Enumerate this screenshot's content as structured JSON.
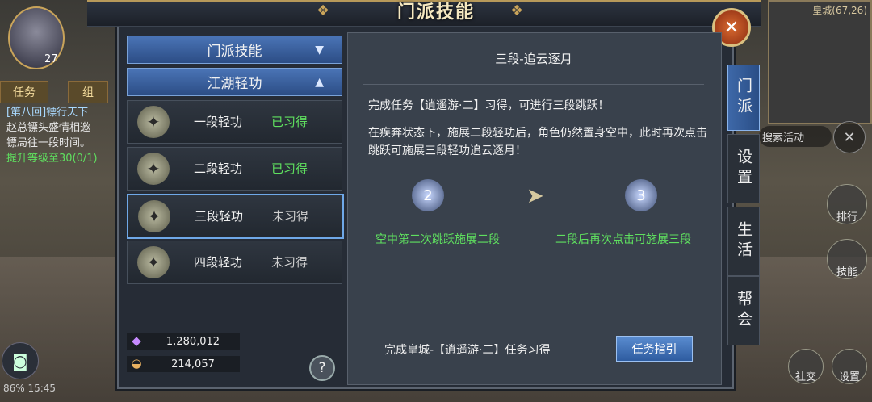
{
  "window": {
    "title": "门派技能"
  },
  "hud": {
    "level": "27",
    "tabs": [
      "任务",
      "组"
    ],
    "quest": {
      "line1": "[第八回]镖行天下",
      "line2": "赵总镖头盛情相邀",
      "line3": "镖局往一段时间。",
      "line4": "提升等级至30(0/1)"
    },
    "status": "86%  15:45",
    "map_coords": "皇城(67,26)",
    "search_activity": "搜索活动",
    "right_buttons": [
      "排行",
      "技能",
      "社交",
      "设置"
    ]
  },
  "menu": {
    "sections": [
      {
        "label": "门派技能",
        "chevron": "V"
      },
      {
        "label": "江湖轻功",
        "chevron": "^"
      }
    ],
    "skills": [
      {
        "name": "一段轻功",
        "status": "已习得",
        "learned": true
      },
      {
        "name": "二段轻功",
        "status": "已习得",
        "learned": true
      },
      {
        "name": "三段轻功",
        "status": "未习得",
        "learned": false
      },
      {
        "name": "四段轻功",
        "status": "未习得",
        "learned": false
      }
    ],
    "currency": {
      "a": "1,280,012",
      "b": "214,057"
    }
  },
  "detail": {
    "title": "三段-追云逐月",
    "text1": "完成任务【逍遥游·二】习得，可进行三段跳跃！",
    "text2": "在疾奔状态下，施展二段轻功后，角色仍然置身空中，此时再次点击跳跃可施展三段轻功追云逐月！",
    "stage1_num": "2",
    "stage1_caption": "空中第二次跳跃施展二段",
    "stage2_num": "3",
    "stage2_caption": "二段后再次点击可施展三段",
    "footer": "完成皇城-【逍遥游·二】任务习得",
    "guide_button": "任务指引"
  },
  "vertical_tabs": [
    "门派",
    "设置",
    "生活",
    "帮会"
  ],
  "colors": {
    "learned": "#5fe05f",
    "accent_blue": "#3e68a8",
    "frame_gold": "#c9a45a"
  }
}
